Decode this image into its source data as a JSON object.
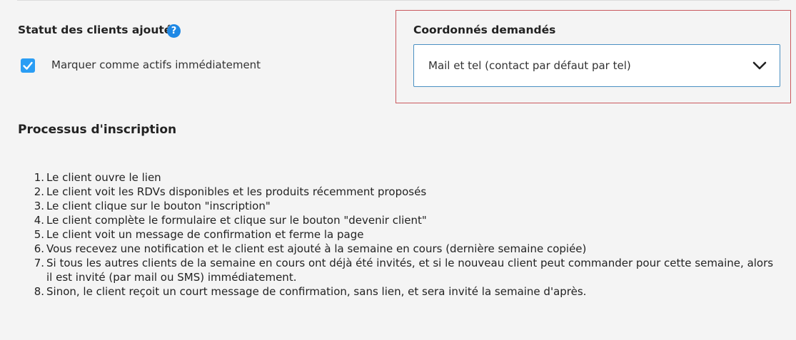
{
  "status_section": {
    "title": "Statut des clients ajoutés",
    "help_icon": "help-icon",
    "checkbox_checked": true,
    "checkbox_label": "Marquer comme actifs immédiatement",
    "accent_color": "#2a9df4"
  },
  "coordinates_section": {
    "title": "Coordonnés demandés",
    "selected_value": "Mail et tel (contact par défaut par tel)",
    "highlight_color": "#c9595e"
  },
  "process_section": {
    "title": "Processus d'inscription",
    "steps": [
      {
        "num": "1.",
        "text": "Le client ouvre le lien"
      },
      {
        "num": "2.",
        "text": "Le client voit les RDVs disponibles et les produits récemment proposés"
      },
      {
        "num": "3.",
        "text": "Le client clique sur le bouton \"inscription\""
      },
      {
        "num": "4.",
        "text": "Le client complète le formulaire et clique sur le bouton \"devenir client\""
      },
      {
        "num": "5.",
        "text": "Le client voit un message de confirmation et ferme la page"
      },
      {
        "num": "6.",
        "text": "Vous recevez une notification et le client est ajouté à la semaine en cours (dernière semaine copiée)"
      },
      {
        "num": "7.",
        "text": "Si tous les autres clients de la semaine en cours ont déjà été invités, et si le nouveau client peut commander pour cette semaine, alors il est invité (par mail ou SMS) immédiatement."
      },
      {
        "num": "8.",
        "text": "Sinon, le client reçoit un court message de confirmation, sans lien, et sera invité la semaine d'après."
      }
    ]
  }
}
